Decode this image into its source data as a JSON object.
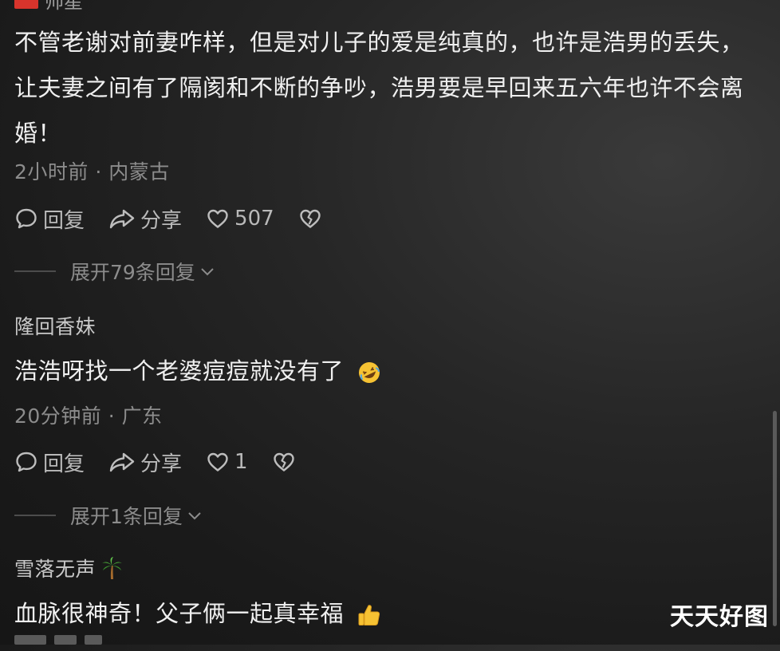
{
  "comments": [
    {
      "username": "帅星",
      "text": "不管老谢对前妻咋样，但是对儿子的爱是纯真的，也许是浩男的丢失，让夫妻之间有了隔阂和不断的争吵，浩男要是早回来五六年也许不会离婚！",
      "meta": "2小时前 · 内蒙古",
      "reply_label": "回复",
      "share_label": "分享",
      "likes": "507",
      "expand_label": "展开79条回复"
    },
    {
      "username": "隆回香妹",
      "text": "浩浩呀找一个老婆痘痘就没有了",
      "text_emoji": "rofl-emoji",
      "meta": "20分钟前 · 广东",
      "reply_label": "回复",
      "share_label": "分享",
      "likes": "1",
      "expand_label": "展开1条回复"
    },
    {
      "username": "雪落无声",
      "username_emoji": "palm-tree-emoji",
      "text": "血脉很神奇！父子俩一起真幸福",
      "text_emoji": "thumbs-up-emoji"
    }
  ],
  "watermark": "天天好图",
  "colors": {
    "background": "#1c1c1c",
    "text": "#f0f0f0",
    "meta": "#8c8c8c",
    "badge": "#d8342c"
  }
}
